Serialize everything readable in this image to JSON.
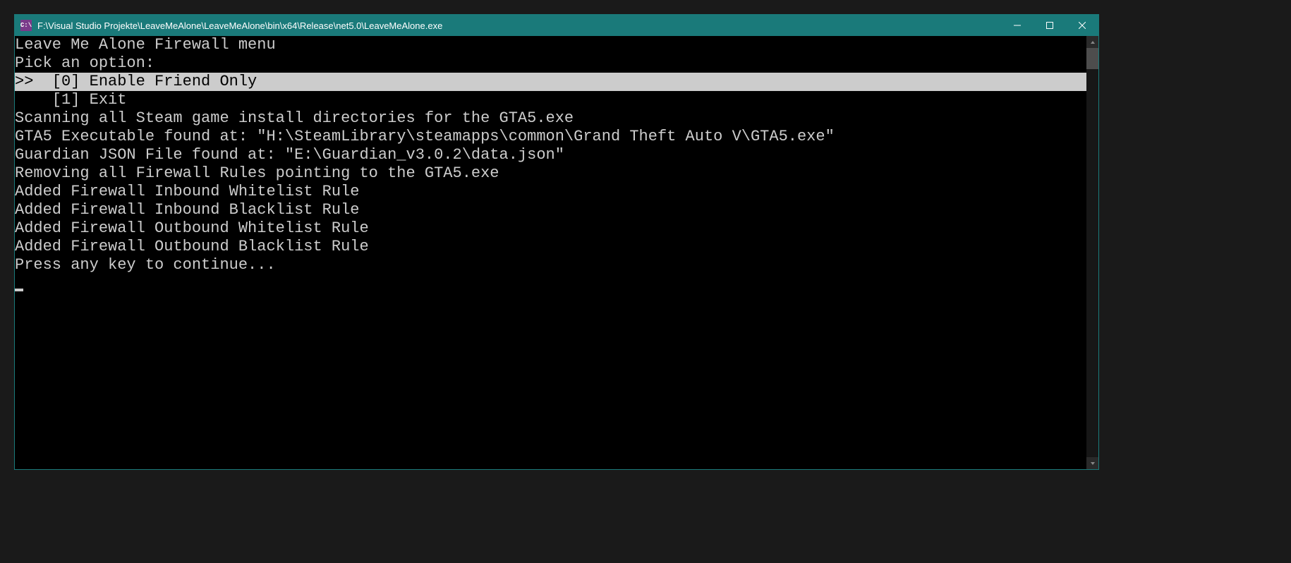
{
  "titlebar": {
    "icon_text": "C:\\",
    "title": "F:\\Visual Studio Projekte\\LeaveMeAlone\\LeaveMeAlone\\bin\\x64\\Release\\net5.0\\LeaveMeAlone.exe"
  },
  "console": {
    "lines": [
      "Leave Me Alone Firewall menu",
      "Pick an option:",
      ">>  [0] Enable Friend Only",
      "    [1] Exit",
      "",
      "Scanning all Steam game install directories for the GTA5.exe",
      "GTA5 Executable found at: \"H:\\SteamLibrary\\steamapps\\common\\Grand Theft Auto V\\GTA5.exe\"",
      "Guardian JSON File found at: \"E:\\Guardian_v3.0.2\\data.json\"",
      "Removing all Firewall Rules pointing to the GTA5.exe",
      "Added Firewall Inbound Whitelist Rule",
      "Added Firewall Inbound Blacklist Rule",
      "Added Firewall Outbound Whitelist Rule",
      "Added Firewall Outbound Blacklist Rule",
      "Press any key to continue..."
    ],
    "highlighted_index": 2
  }
}
